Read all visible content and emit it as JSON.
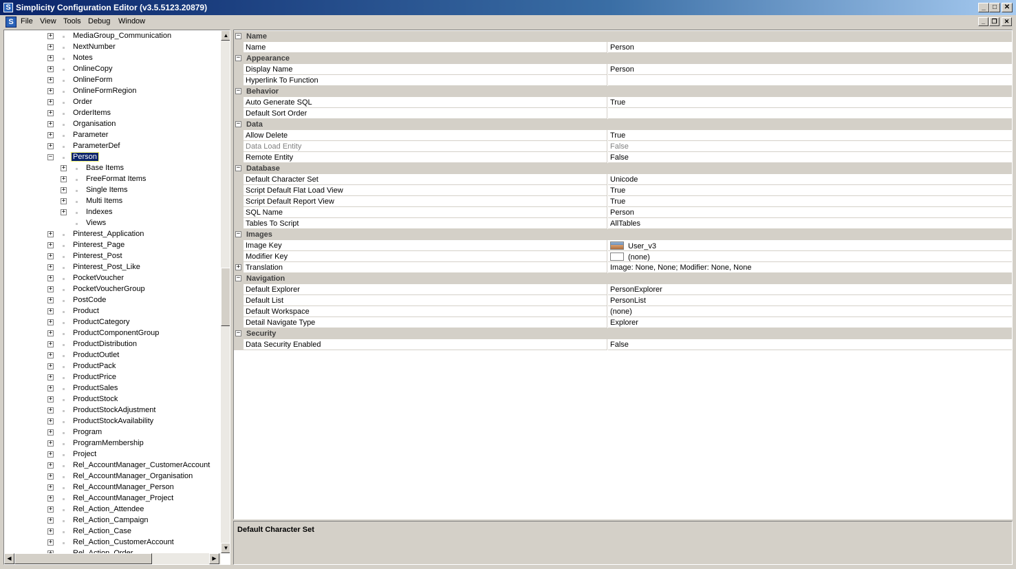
{
  "window": {
    "title": "Simplicity Configuration Editor (v3.5.5123.20879)",
    "app_icon": "S",
    "controls": [
      "_",
      "□",
      "✕"
    ]
  },
  "menu": {
    "items": [
      "File",
      "View",
      "Tools",
      "Debug",
      "Window"
    ],
    "mdi_controls": [
      "_",
      "❐",
      "✕"
    ]
  },
  "tree": {
    "selected": "Person",
    "items": [
      {
        "label": "MediaGroup_Communication",
        "level": 0,
        "expander": "+"
      },
      {
        "label": "NextNumber",
        "level": 0,
        "expander": "+"
      },
      {
        "label": "Notes",
        "level": 0,
        "expander": "+"
      },
      {
        "label": "OnlineCopy",
        "level": 0,
        "expander": "+"
      },
      {
        "label": "OnlineForm",
        "level": 0,
        "expander": "+"
      },
      {
        "label": "OnlineFormRegion",
        "level": 0,
        "expander": "+"
      },
      {
        "label": "Order",
        "level": 0,
        "expander": "+"
      },
      {
        "label": "OrderItems",
        "level": 0,
        "expander": "+"
      },
      {
        "label": "Organisation",
        "level": 0,
        "expander": "+"
      },
      {
        "label": "Parameter",
        "level": 0,
        "expander": "+"
      },
      {
        "label": "ParameterDef",
        "level": 0,
        "expander": "+"
      },
      {
        "label": "Person",
        "level": 0,
        "expander": "−",
        "selected": true
      },
      {
        "label": "Base Items",
        "level": 1,
        "expander": "+"
      },
      {
        "label": "FreeFormat Items",
        "level": 1,
        "expander": "+"
      },
      {
        "label": "Single Items",
        "level": 1,
        "expander": "+"
      },
      {
        "label": "Multi Items",
        "level": 1,
        "expander": "+"
      },
      {
        "label": "Indexes",
        "level": 1,
        "expander": "+"
      },
      {
        "label": "Views",
        "level": 1,
        "expander": ""
      },
      {
        "label": "Pinterest_Application",
        "level": 0,
        "expander": "+"
      },
      {
        "label": "Pinterest_Page",
        "level": 0,
        "expander": "+"
      },
      {
        "label": "Pinterest_Post",
        "level": 0,
        "expander": "+"
      },
      {
        "label": "Pinterest_Post_Like",
        "level": 0,
        "expander": "+"
      },
      {
        "label": "PocketVoucher",
        "level": 0,
        "expander": "+"
      },
      {
        "label": "PocketVoucherGroup",
        "level": 0,
        "expander": "+"
      },
      {
        "label": "PostCode",
        "level": 0,
        "expander": "+"
      },
      {
        "label": "Product",
        "level": 0,
        "expander": "+"
      },
      {
        "label": "ProductCategory",
        "level": 0,
        "expander": "+"
      },
      {
        "label": "ProductComponentGroup",
        "level": 0,
        "expander": "+"
      },
      {
        "label": "ProductDistribution",
        "level": 0,
        "expander": "+"
      },
      {
        "label": "ProductOutlet",
        "level": 0,
        "expander": "+"
      },
      {
        "label": "ProductPack",
        "level": 0,
        "expander": "+"
      },
      {
        "label": "ProductPrice",
        "level": 0,
        "expander": "+"
      },
      {
        "label": "ProductSales",
        "level": 0,
        "expander": "+"
      },
      {
        "label": "ProductStock",
        "level": 0,
        "expander": "+"
      },
      {
        "label": "ProductStockAdjustment",
        "level": 0,
        "expander": "+"
      },
      {
        "label": "ProductStockAvailability",
        "level": 0,
        "expander": "+"
      },
      {
        "label": "Program",
        "level": 0,
        "expander": "+"
      },
      {
        "label": "ProgramMembership",
        "level": 0,
        "expander": "+"
      },
      {
        "label": "Project",
        "level": 0,
        "expander": "+"
      },
      {
        "label": "Rel_AccountManager_CustomerAccount",
        "level": 0,
        "expander": "+"
      },
      {
        "label": "Rel_AccountManager_Organisation",
        "level": 0,
        "expander": "+"
      },
      {
        "label": "Rel_AccountManager_Person",
        "level": 0,
        "expander": "+"
      },
      {
        "label": "Rel_AccountManager_Project",
        "level": 0,
        "expander": "+"
      },
      {
        "label": "Rel_Action_Attendee",
        "level": 0,
        "expander": "+"
      },
      {
        "label": "Rel_Action_Campaign",
        "level": 0,
        "expander": "+"
      },
      {
        "label": "Rel_Action_Case",
        "level": 0,
        "expander": "+"
      },
      {
        "label": "Rel_Action_CustomerAccount",
        "level": 0,
        "expander": "+"
      },
      {
        "label": "Rel_Action_Order",
        "level": 0,
        "expander": "+"
      }
    ],
    "scroll_up_icon": "▲",
    "scroll_down_icon": "▼",
    "scroll_left_icon": "◀",
    "scroll_right_icon": "▶"
  },
  "properties": {
    "rows": [
      {
        "type": "category",
        "label": "Name",
        "toggle": "−"
      },
      {
        "type": "prop",
        "name": "Name",
        "value": "Person"
      },
      {
        "type": "category",
        "label": "Appearance",
        "toggle": "−"
      },
      {
        "type": "prop",
        "name": "Display Name",
        "value": "Person"
      },
      {
        "type": "prop",
        "name": "Hyperlink To Function",
        "value": ""
      },
      {
        "type": "category",
        "label": "Behavior",
        "toggle": "−"
      },
      {
        "type": "prop",
        "name": "Auto Generate SQL",
        "value": "True"
      },
      {
        "type": "prop",
        "name": "Default Sort Order",
        "value": ""
      },
      {
        "type": "category",
        "label": "Data",
        "toggle": "−"
      },
      {
        "type": "prop",
        "name": "Allow Delete",
        "value": "True"
      },
      {
        "type": "prop",
        "name": "Data Load Entity",
        "value": "False",
        "readonly": true
      },
      {
        "type": "prop",
        "name": "Remote Entity",
        "value": "False"
      },
      {
        "type": "category",
        "label": "Database",
        "toggle": "−"
      },
      {
        "type": "prop",
        "name": "Default Character Set",
        "value": "Unicode"
      },
      {
        "type": "prop",
        "name": "Script Default Flat Load View",
        "value": "True"
      },
      {
        "type": "prop",
        "name": "Script Default Report View",
        "value": "True"
      },
      {
        "type": "prop",
        "name": "SQL Name",
        "value": "Person"
      },
      {
        "type": "prop",
        "name": "Tables To Script",
        "value": "AllTables"
      },
      {
        "type": "category",
        "label": "Images",
        "toggle": "−"
      },
      {
        "type": "prop",
        "name": "Image Key",
        "value": "User_v3",
        "swatch": "user"
      },
      {
        "type": "prop",
        "name": "Modifier Key",
        "value": "(none)",
        "swatch": "none"
      },
      {
        "type": "prop",
        "name": "Translation",
        "value": "Image: None, None; Modifier: None, None",
        "expander": "+"
      },
      {
        "type": "category",
        "label": "Navigation",
        "toggle": "−"
      },
      {
        "type": "prop",
        "name": "Default Explorer",
        "value": "PersonExplorer"
      },
      {
        "type": "prop",
        "name": "Default List",
        "value": "PersonList"
      },
      {
        "type": "prop",
        "name": "Default Workspace",
        "value": "(none)"
      },
      {
        "type": "prop",
        "name": "Detail Navigate Type",
        "value": "Explorer"
      },
      {
        "type": "category",
        "label": "Security",
        "toggle": "−"
      },
      {
        "type": "prop",
        "name": "Data Security Enabled",
        "value": "False"
      }
    ]
  },
  "help": {
    "title": "Default Character Set",
    "description": ""
  }
}
